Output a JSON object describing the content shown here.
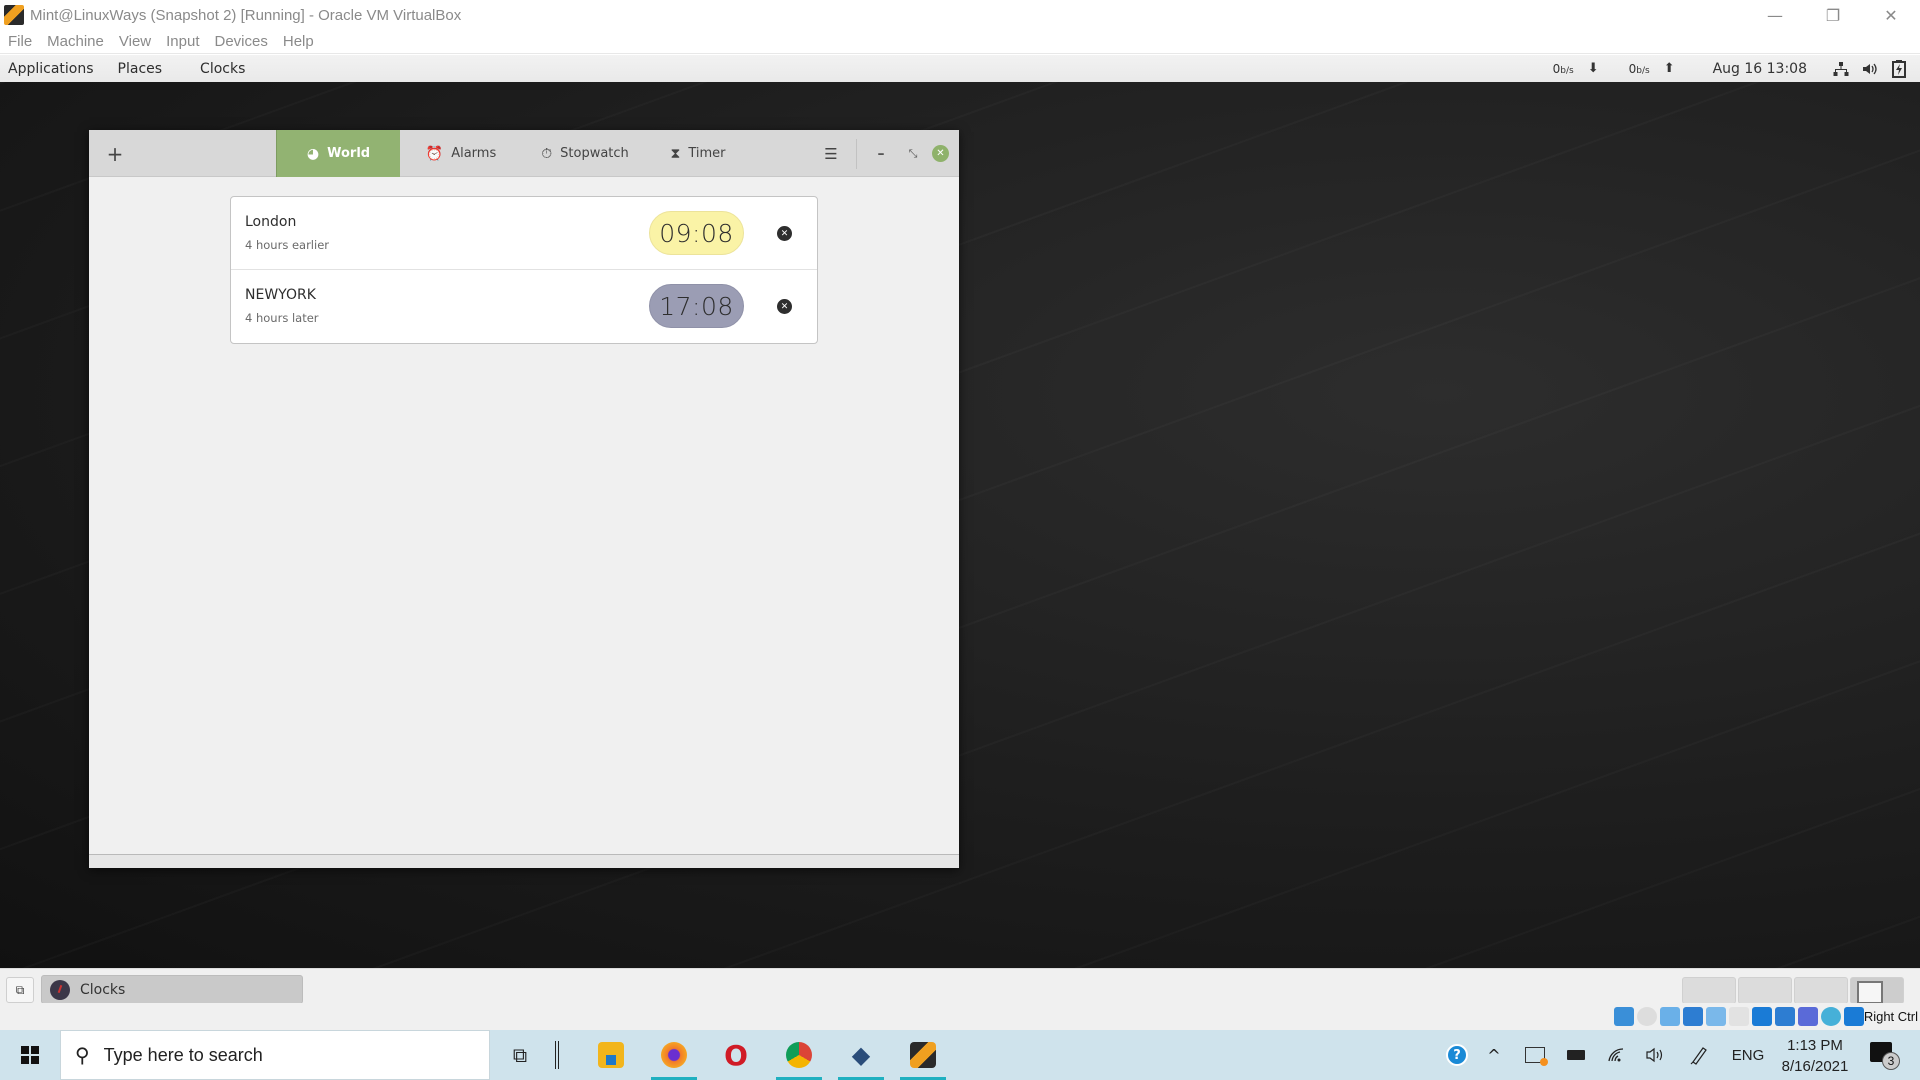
{
  "host_window": {
    "title": "Mint@LinuxWays (Snapshot 2) [Running] - Oracle VM VirtualBox",
    "controls": {
      "minimize": "—",
      "restore": "❐",
      "close": "✕"
    },
    "menu": [
      "File",
      "Machine",
      "View",
      "Input",
      "Devices",
      "Help"
    ]
  },
  "mint_top_panel": {
    "menus": [
      "Applications",
      "Places",
      "Clocks"
    ],
    "net_down": {
      "value": "0",
      "unit": "b/s",
      "arrow": "⬇"
    },
    "net_up": {
      "value": "0",
      "unit": "b/s",
      "arrow": "⬆"
    },
    "datetime": "Aug 16  13:08",
    "tray_icons": [
      "network-icon",
      "volume-icon",
      "battery-icon"
    ]
  },
  "clocks_app": {
    "add_label": "+",
    "tabs": [
      {
        "label": "World",
        "icon": "globe-icon",
        "glyph": "◕",
        "active": true
      },
      {
        "label": "Alarms",
        "icon": "alarm-clock-icon",
        "glyph": "⏰",
        "active": false
      },
      {
        "label": "Stopwatch",
        "icon": "stopwatch-icon",
        "glyph": "⏱",
        "active": false
      },
      {
        "label": "Timer",
        "icon": "hourglass-icon",
        "glyph": "⧗",
        "active": false
      }
    ],
    "menu_glyph": "☰",
    "win_min": "–",
    "win_max": "⤡",
    "win_close": "✕",
    "world_clocks": [
      {
        "city": "London",
        "offset": "4 hours earlier",
        "time": "09:08",
        "period": "day",
        "pill_color": "#faf3a6"
      },
      {
        "city": "NEWYORK",
        "offset": "4 hours later",
        "time": "17:08",
        "period": "night",
        "pill_color": "#9b9db4"
      }
    ],
    "remove_glyph": "✕",
    "accent_color": "#92b372"
  },
  "mint_bottom_panel": {
    "show_desktop_glyph": "⧉",
    "tasks": [
      {
        "label": "Clocks",
        "active": true
      }
    ],
    "workspaces": 4,
    "active_workspace": 4
  },
  "vbox_status": {
    "host_key": "Right Ctrl"
  },
  "windows_taskbar": {
    "search_placeholder": "Type here to search",
    "search_glyph": "⚲",
    "task_view_glyph": "⧉",
    "apps": [
      {
        "name": "file-explorer",
        "glyph": "▬",
        "color": "#f2b51c",
        "running": false
      },
      {
        "name": "firefox",
        "glyph": "●",
        "color": "#e8642c",
        "running": true
      },
      {
        "name": "opera",
        "glyph": "O",
        "color": "#d01b26",
        "running": false
      },
      {
        "name": "chrome",
        "glyph": "◉",
        "color": "#2f9a4a",
        "running": true
      },
      {
        "name": "virtualbox",
        "glyph": "◆",
        "color": "#2a4d7a",
        "running": true
      },
      {
        "name": "virtualbox-vm",
        "glyph": "▞",
        "color": "#f0a020",
        "running": true
      }
    ],
    "tray": {
      "help_glyph": "?",
      "chevron_glyph": "^",
      "language": "ENG",
      "time": "1:13 PM",
      "date": "8/16/2021",
      "notifications": "3"
    }
  }
}
